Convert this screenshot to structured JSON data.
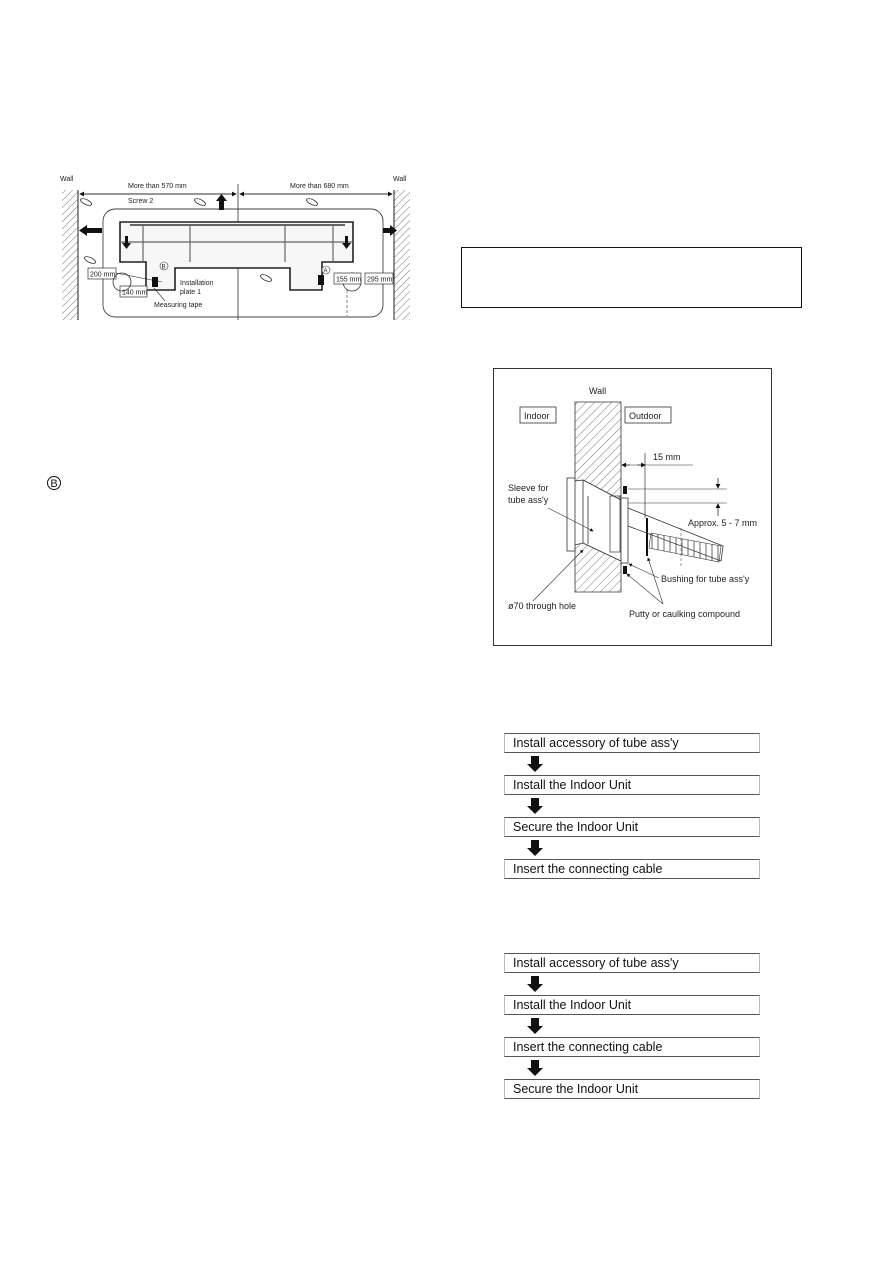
{
  "installation_plate_diagram": {
    "wall_left_label": "Wall",
    "wall_right_label": "Wall",
    "dim_left": "More than 570 mm",
    "dim_right": "More than 680 mm",
    "screw_label": "Screw  2",
    "installation_plate_label_line1": "Installation",
    "installation_plate_label_line2": "plate  1",
    "measuring_tape_label": "Measuring tape",
    "dim_200": "200 mm",
    "dim_140": "140 mm",
    "dim_155": "155 mm",
    "dim_295": "295 mm",
    "marker_a": "A",
    "marker_b": "B"
  },
  "left_column": {
    "circled_marker": "B"
  },
  "note_box": {
    "text": ""
  },
  "wall_section_diagram": {
    "wall_label": "Wall",
    "indoor_label": "Indoor",
    "outdoor_label": "Outdoor",
    "dim_15": "15 mm",
    "approx_label": "Approx. 5 - 7 mm",
    "sleeve_label_line1": "Sleeve for",
    "sleeve_label_line2": "tube ass'y",
    "bushing_label": "Bushing for tube ass'y",
    "through_hole_label": "ø70 through hole",
    "putty_label": "Putty or caulking compound"
  },
  "flowchart_1": {
    "steps": [
      "Install accessory of tube ass'y",
      "Install the Indoor Unit",
      "Secure the Indoor Unit",
      "Insert the connecting cable"
    ]
  },
  "flowchart_2": {
    "steps": [
      "Install accessory of tube ass'y",
      "Install the Indoor Unit",
      "Insert the connecting cable",
      "Secure the Indoor Unit"
    ]
  }
}
